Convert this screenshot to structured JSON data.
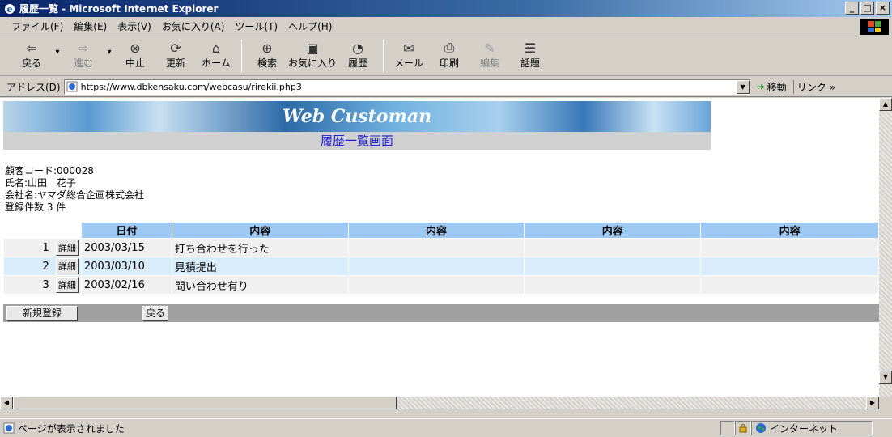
{
  "window": {
    "title": "履歴一覧 - Microsoft Internet Explorer",
    "controls": [
      "_",
      "□",
      "×"
    ]
  },
  "menu": [
    "ファイル(F)",
    "編集(E)",
    "表示(V)",
    "お気に入り(A)",
    "ツール(T)",
    "ヘルプ(H)"
  ],
  "toolbar": {
    "back": "戻る",
    "forward": "進む",
    "stop": "中止",
    "refresh": "更新",
    "home": "ホーム",
    "search": "検索",
    "favorites": "お気に入り",
    "history": "履歴",
    "mail": "メール",
    "print": "印刷",
    "edit": "編集",
    "discuss": "話題"
  },
  "address": {
    "label": "アドレス(D)",
    "url": "https://www.dbkensaku.com/webcasu/rirekii.php3",
    "go": "移動",
    "links": "リンク »"
  },
  "page": {
    "brand": "Web Customan",
    "subtitle": "履歴一覧画面",
    "customer_code": "顧客コード:000028",
    "name": "氏名:山田　花子",
    "company": "会社名:ヤマダ総合企画株式会社",
    "count": "登録件数 3 件",
    "columns": [
      "日付",
      "内容",
      "内容",
      "内容",
      "内容"
    ],
    "detail_label": "詳細",
    "rows": [
      {
        "no": "1",
        "date": "2003/03/15",
        "content": "打ち合わせを行った"
      },
      {
        "no": "2",
        "date": "2003/03/10",
        "content": "見積提出"
      },
      {
        "no": "3",
        "date": "2003/02/16",
        "content": "問い合わせ有り"
      }
    ],
    "new_button": "新規登録",
    "back_button": "戻る"
  },
  "status": {
    "message": "ページが表示されました",
    "zone": "インターネット"
  }
}
